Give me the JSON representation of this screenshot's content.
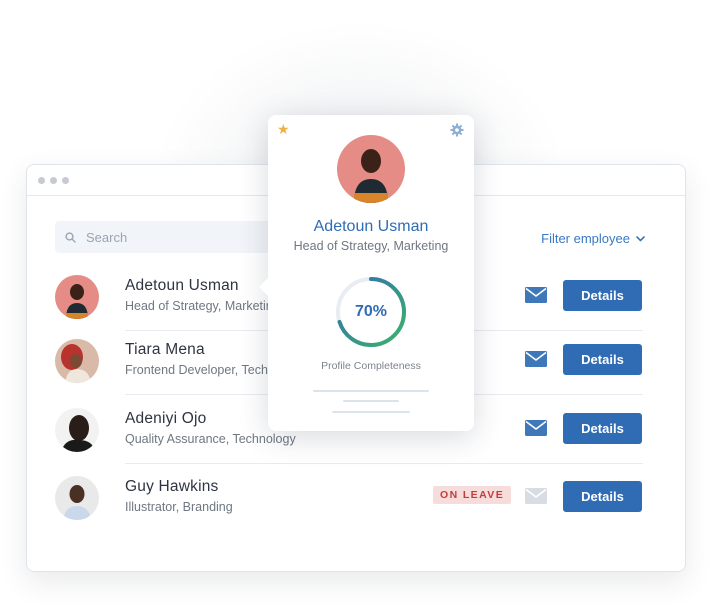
{
  "search": {
    "placeholder": "Search"
  },
  "filter": {
    "label": "Filter employee"
  },
  "employees": [
    {
      "name": "Adetoun Usman",
      "role": "Head of Strategy, Marketing",
      "details_label": "Details",
      "status": ""
    },
    {
      "name": "Tiara Mena",
      "role": "Frontend Developer, Technology",
      "details_label": "Details",
      "status": ""
    },
    {
      "name": "Adeniyi Ojo",
      "role": "Quality Assurance, Technology",
      "details_label": "Details",
      "status": ""
    },
    {
      "name": "Guy Hawkins",
      "role": "Illustrator, Branding",
      "details_label": "Details",
      "status": "ON LEAVE"
    }
  ],
  "popup": {
    "name": "Adetoun Usman",
    "role": "Head of Strategy, Marketing",
    "completeness_value": 0.7,
    "completeness_text": "70%",
    "completeness_label": "Profile Completeness"
  },
  "colors": {
    "accent": "#2f6cb3",
    "progress_start": "#3db36b",
    "progress_end": "#2f6cb3",
    "leave_bg": "#f7dcdc",
    "leave_text": "#c23d3d",
    "star": "#f2b13d"
  },
  "icons": [
    "search-icon",
    "chevron-down-icon",
    "mail-icon",
    "star-icon",
    "gear-icon"
  ]
}
